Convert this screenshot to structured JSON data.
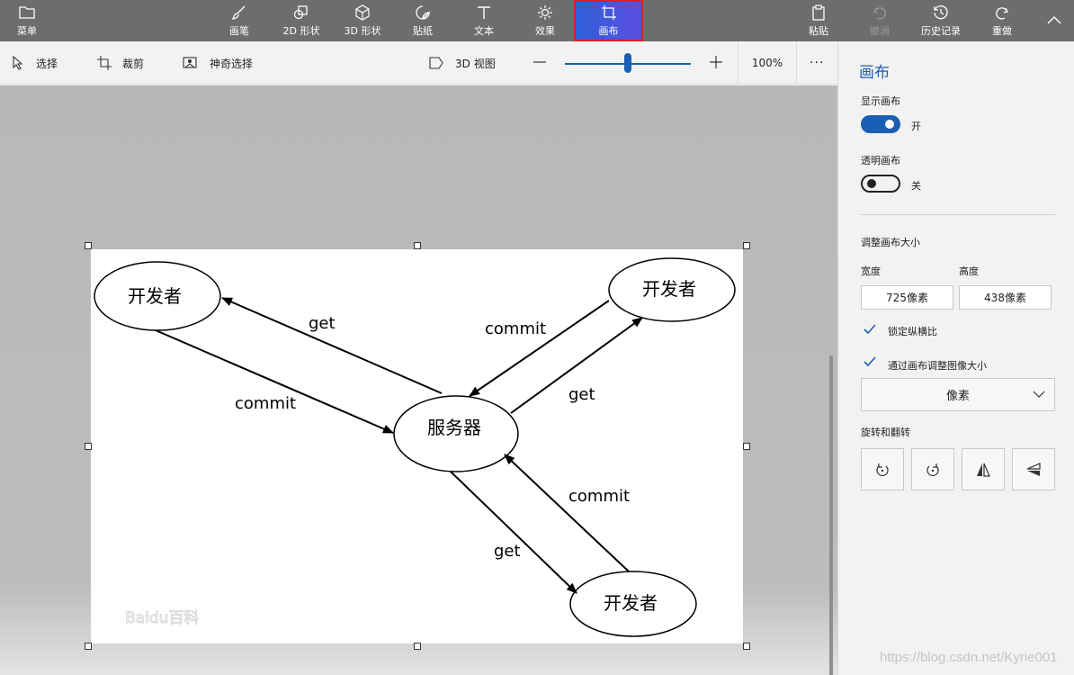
{
  "toolbar": {
    "menu_label": "菜单",
    "tools": [
      {
        "label": "画笔",
        "icon": "brush-icon"
      },
      {
        "label": "2D 形状",
        "icon": "shapes-2d-icon"
      },
      {
        "label": "3D 形状",
        "icon": "cube-3d-icon"
      },
      {
        "label": "贴纸",
        "icon": "sticker-icon"
      },
      {
        "label": "文本",
        "icon": "text-icon"
      },
      {
        "label": "效果",
        "icon": "effects-sun-icon"
      },
      {
        "label": "画布",
        "icon": "canvas-crop-icon"
      }
    ],
    "active_tool": "画布",
    "paste_label": "粘贴",
    "undo_label": "撤消",
    "history_label": "历史记录",
    "redo_label": "重做"
  },
  "subbar": {
    "select_label": "选择",
    "crop_label": "裁剪",
    "magic_select_label": "神奇选择",
    "view3d_label": "3D 视图",
    "zoom_percent": "100%",
    "zoom_level": 0.5,
    "more_label": "···"
  },
  "canvas": {
    "diagram": {
      "nodes": {
        "dev_top_left": "开发者",
        "dev_top_right": "开发者",
        "server": "服务器",
        "dev_bottom": "开发者"
      },
      "labels": {
        "get1": "get",
        "commit1": "commit",
        "commit2": "commit",
        "get2": "get",
        "commit3": "commit",
        "get3": "get"
      },
      "watermark": "Baidu百科"
    }
  },
  "panel": {
    "title": "画布",
    "show_canvas_label": "显示画布",
    "show_canvas_state": "开",
    "transparent_label": "透明画布",
    "transparent_state": "关",
    "resize_label": "调整画布大小",
    "width_label": "宽度",
    "height_label": "高度",
    "width_value": "725像素",
    "height_value": "438像素",
    "lock_ratio_label": "锁定纵横比",
    "resize_image_label": "通过画布调整图像大小",
    "unit_value": "像素",
    "rotate_label": "旋转和翻转"
  },
  "watermark": "https://blog.csdn.net/Kyrie001",
  "colors": {
    "accent": "#1a5fb4",
    "toolbar_bg": "#6d6d6d",
    "active_border": "#e02020"
  }
}
